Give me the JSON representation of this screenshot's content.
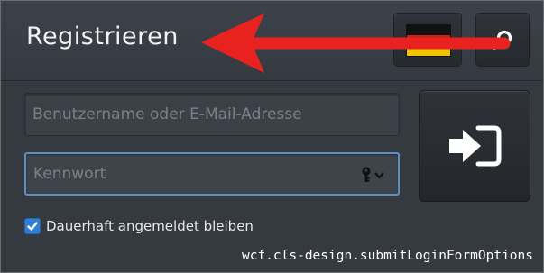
{
  "header": {
    "title": "Registrieren",
    "language_flag": "germany-flag",
    "search_icon": "search-icon"
  },
  "login": {
    "username_placeholder": "Benutzername oder E-Mail-Adresse",
    "username_value": "",
    "password_placeholder": "Kennwort",
    "password_value": "",
    "key_icon": "key-icon",
    "submit_icon": "sign-in-icon"
  },
  "remember": {
    "label": "Dauerhaft angemeldet bleiben",
    "checked": true
  },
  "tooltip": {
    "text": "wcf.cls-design.submitLoginFormOptions"
  },
  "colors": {
    "accent": "#2f7fd6",
    "focus_border": "#5d8fc2",
    "annotation_arrow": "#e8231f",
    "background": "#353a41"
  }
}
